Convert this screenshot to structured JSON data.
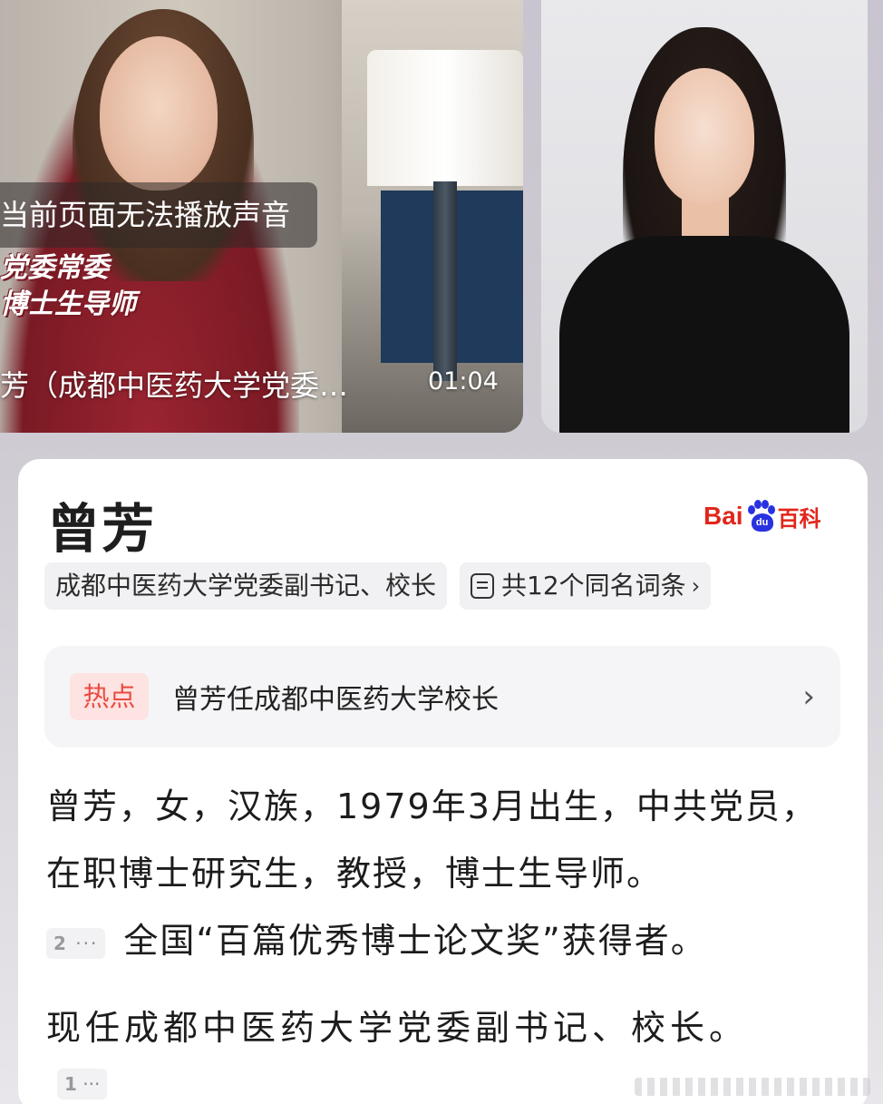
{
  "video": {
    "sound_notice": "当前页面无法播放声音",
    "caption_line1": "党委常委",
    "caption_line2": "博士生导师",
    "title": "芳（成都中医药大学党委…",
    "duration": "01:04"
  },
  "entry": {
    "title": "曾芳",
    "brand": {
      "bai": "Bai",
      "du": "du",
      "baike": "百科"
    },
    "tags": {
      "description": "成都中医药大学党委副书记、校长",
      "same_name": "共12个同名词条",
      "same_name_icon": "document-list-icon"
    },
    "hot": {
      "badge": "热点",
      "text": "曾芳任成都中医药大学校长"
    },
    "paragraph1_main": "曾芳，女，汉族，1979年3月出生，中共党员，在职博士研究生，教授，博士生导师。",
    "ref1": "2",
    "paragraph1_tail": "全国“百篇优秀博士论文奖”获得者。",
    "paragraph2": "现任成都中医药大学党委副书记、校长。",
    "ref2": "1",
    "ref_more": "···"
  },
  "colors": {
    "accent_red": "#e1261c",
    "baidu_blue": "#2932e1",
    "hot_badge_bg": "#fde3e2",
    "hot_badge_text": "#ea4b3f"
  }
}
